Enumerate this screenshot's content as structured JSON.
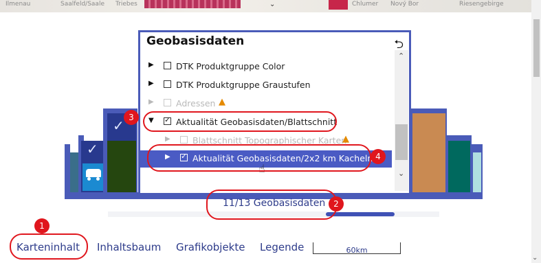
{
  "map_strip": {
    "labels": [
      "Ilmenau",
      "Saalfeld/Saale",
      "Triebes",
      "Chlumer",
      "Nový Bor",
      "Riesengebirge"
    ]
  },
  "modal": {
    "title": "Geobasisdaten",
    "back_icon": "undo-arrow-icon",
    "rows": [
      {
        "label": "DTK Produktgruppe Color",
        "checked": false,
        "disabled": false,
        "expanded": false,
        "warning": false
      },
      {
        "label": "DTK Produktgruppe Graustufen",
        "checked": false,
        "disabled": false,
        "expanded": false,
        "warning": false
      },
      {
        "label": "Adressen",
        "checked": false,
        "disabled": true,
        "expanded": false,
        "warning": true
      },
      {
        "label": "Aktualität Geobasisdaten/Blattschnitt",
        "checked": true,
        "disabled": false,
        "expanded": true,
        "warning": false
      },
      {
        "label": "Blattschnitt Topographischer Karten",
        "checked": false,
        "disabled": true,
        "expanded": false,
        "warning": true
      },
      {
        "label": "Aktualität Geobasisdaten/2x2 km Kacheln",
        "checked": true,
        "disabled": false,
        "expanded": false,
        "warning": false,
        "selected": true
      }
    ]
  },
  "counter": "11/13 Geobasisdaten",
  "tabs": [
    "Karteninhalt",
    "Inhaltsbaum",
    "Grafikobjekte",
    "Legende"
  ],
  "scale": "60km",
  "annotations": [
    "1",
    "2",
    "3",
    "4"
  ],
  "colors": {
    "accent": "#3f51b5",
    "modal_border": "#4a5bb8",
    "selection": "#4a5bc4",
    "annotation": "#e0161d",
    "warning": "#e58a00"
  }
}
